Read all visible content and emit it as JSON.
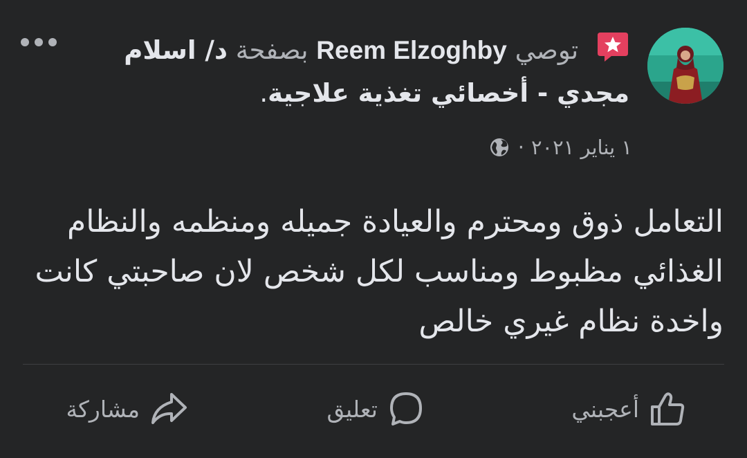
{
  "post": {
    "author": "Reem Elzoghby",
    "recommends_label": "توصي",
    "page_prefix": "بصفحة",
    "page_name": "د/ اسلام مجدي - أخصائي تغذية علاجية",
    "period": ".",
    "date": "١ يناير ٢٠٢١",
    "date_separator": "·",
    "privacy_icon": "globe-icon",
    "recommend_icon": "recommend-star-icon",
    "body": "التعامل ذوق ومحترم والعيادة جميله ومنظمه والنظام الغذائي مظبوط ومناسب لكل شخص لان صاحبتي كانت واخدة نظام غيري خالص"
  },
  "actions": {
    "like_label": "أعجبني",
    "comment_label": "تعليق",
    "share_label": "مشاركة"
  },
  "colors": {
    "background": "#242526",
    "primary_text": "#e4e6eb",
    "secondary_text": "#b0b3b8",
    "recommend_badge": "#e4405f",
    "divider": "#3e4042"
  }
}
